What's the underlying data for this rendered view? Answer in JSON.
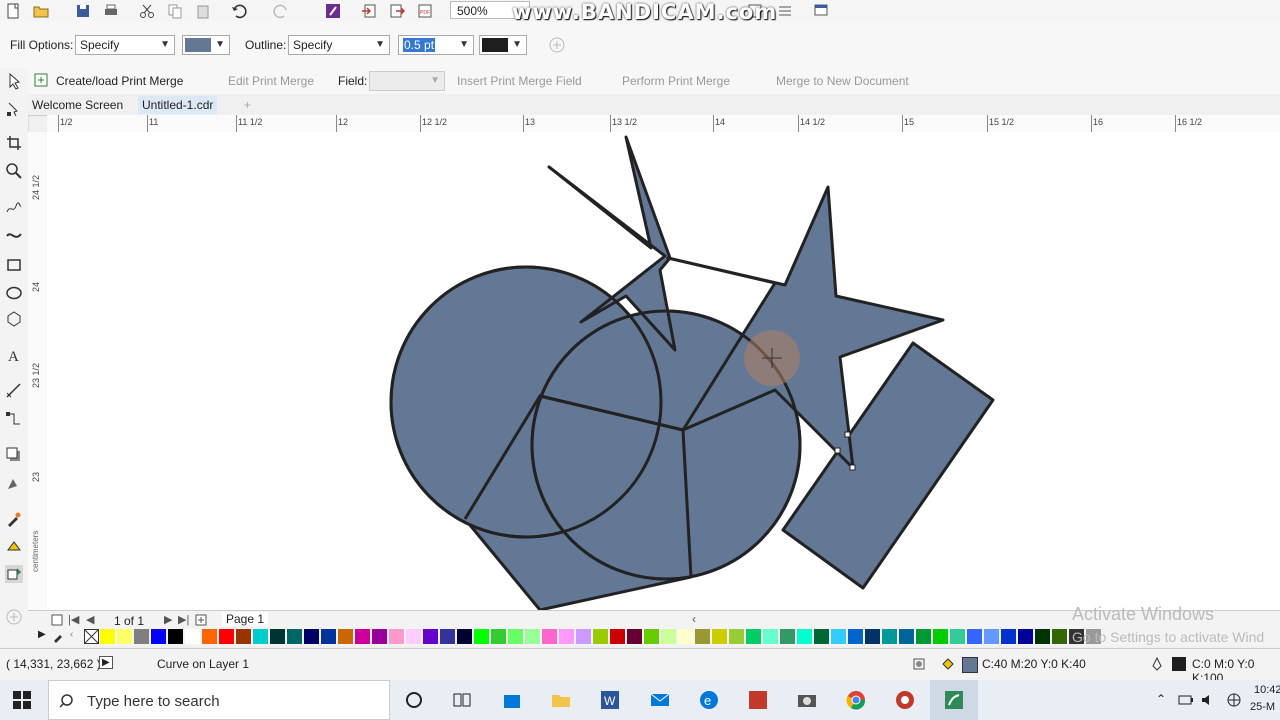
{
  "toolbar": {
    "zoom": "500%",
    "watermark": "www.BANDICAM.com"
  },
  "property_bar": {
    "fill_options_label": "Fill Options:",
    "fill_options_value": "Specify",
    "fill_color": "#637895",
    "outline_label": "Outline:",
    "outline_value": "Specify",
    "outline_width": "0.5 pt",
    "outline_color": "#1e1e1e"
  },
  "merge_bar": {
    "create_load": "Create/load Print Merge",
    "edit": "Edit Print Merge",
    "field_label": "Field:",
    "insert": "Insert Print Merge Field",
    "perform": "Perform Print Merge",
    "merge_new": "Merge to New Document"
  },
  "tabs": {
    "welcome": "Welcome Screen",
    "doc": "Untitled-1.cdr"
  },
  "ruler": {
    "h_labels": [
      "1/2",
      "11",
      "11 1/2",
      "12",
      "12 1/2",
      "13",
      "13 1/2",
      "14",
      "14 1/2",
      "15",
      "15 1/2",
      "16",
      "16 1/2"
    ],
    "v_labels": [
      "24 1/2",
      "24",
      "23 1/2",
      "23"
    ],
    "unit": "centimeters"
  },
  "page_nav": {
    "page_count": "1 of 1",
    "page_tab": "Page 1"
  },
  "palette": {
    "colors": [
      "#ffff00",
      "#ffff66",
      "#7f7f7f",
      "#0000ff",
      "#000000",
      "#ffffff",
      "#ff6600",
      "#ff0000",
      "#993300",
      "#00cccc",
      "#003333",
      "#006666",
      "#000066",
      "#003399",
      "#cc6600",
      "#cc0099",
      "#990099",
      "#ff99cc",
      "#ffccff",
      "#6600cc",
      "#333399",
      "#000033",
      "#00ff00",
      "#33cc33",
      "#66ff66",
      "#99ff99",
      "#ff66cc",
      "#ff99ff",
      "#cc99ff",
      "#99cc00",
      "#cc0000",
      "#660033",
      "#66cc00",
      "#ccff99",
      "#ffffcc",
      "#999933",
      "#cccc00",
      "#99cc33",
      "#00cc66",
      "#66ffcc",
      "#339966",
      "#00ffcc",
      "#006633",
      "#33ccff",
      "#0066cc",
      "#003366",
      "#009999",
      "#006699",
      "#009933",
      "#00cc00",
      "#33cc99",
      "#3366ff",
      "#6699ff",
      "#0033cc",
      "#000099",
      "#003300",
      "#336600",
      "#333333",
      "#999999"
    ]
  },
  "status": {
    "coords": "( 14,331, 23,662 )",
    "object": "Curve on Layer 1",
    "fill_text": "C:40 M:20 Y:0 K:40",
    "outline_text": "C:0 M:0 Y:0 K:100"
  },
  "activate": {
    "line1": "Activate Windows",
    "line2": "Go to Settings to activate Wind"
  },
  "taskbar": {
    "search_placeholder": "Type here to search",
    "time": "10:42",
    "date": "25-M"
  }
}
